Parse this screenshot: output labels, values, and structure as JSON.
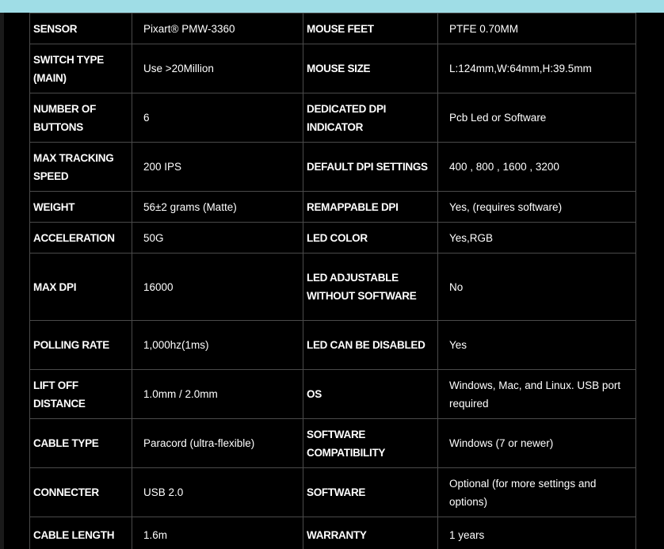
{
  "colors": {
    "top_band": "#9fdde6",
    "background": "#000000",
    "grid_lines": "#4a4a4a",
    "text": "#ffffff"
  },
  "specs": [
    {
      "label_left": "SENSOR",
      "value_left": "Pixart® PMW-3360",
      "label_right": "MOUSE FEET",
      "value_right": "PTFE 0.70MM"
    },
    {
      "label_left": "SWITCH TYPE (MAIN)",
      "value_left": "Use >20Million",
      "label_right": "MOUSE SIZE",
      "value_right": "L:124mm,W:64mm,H:39.5mm"
    },
    {
      "label_left": "NUMBER OF BUTTONS",
      "value_left": "6",
      "label_right": "DEDICATED DPI INDICATOR",
      "value_right": "Pcb Led or Software"
    },
    {
      "label_left": "MAX TRACKING SPEED",
      "value_left": "200 IPS",
      "label_right": "DEFAULT DPI SETTINGS",
      "value_right": "400 , 800 , 1600 , 3200"
    },
    {
      "label_left": "WEIGHT",
      "value_left": "56±2 grams (Matte)",
      "label_right": "REMAPPABLE DPI",
      "value_right": "Yes, (requires software)"
    },
    {
      "label_left": "ACCELERATION",
      "value_left": "50G",
      "label_right": "LED COLOR",
      "value_right": "Yes,RGB"
    },
    {
      "label_left": "MAX DPI",
      "value_left": "16000",
      "label_right": "LED ADJUSTABLE WITHOUT SOFTWARE",
      "value_right": "No"
    },
    {
      "label_left": "POLLING RATE",
      "value_left": "1,000hz(1ms)",
      "label_right": "LED CAN BE DISABLED",
      "value_right": "Yes"
    },
    {
      "label_left": "LIFT OFF DISTANCE",
      "value_left": "1.0mm / 2.0mm",
      "label_right": "OS",
      "value_right": "Windows, Mac, and Linux. USB port required"
    },
    {
      "label_left": "CABLE TYPE",
      "value_left": "Paracord (ultra-flexible)",
      "label_right": "SOFTWARE COMPATIBILITY",
      "value_right": "Windows (7 or newer)"
    },
    {
      "label_left": "CONNECTER",
      "value_left": "USB 2.0",
      "label_right": "SOFTWARE",
      "value_right": "Optional (for more settings and options)"
    },
    {
      "label_left": "CABLE LENGTH",
      "value_left": "1.6m",
      "label_right": "WARRANTY",
      "value_right": "1 years"
    }
  ]
}
